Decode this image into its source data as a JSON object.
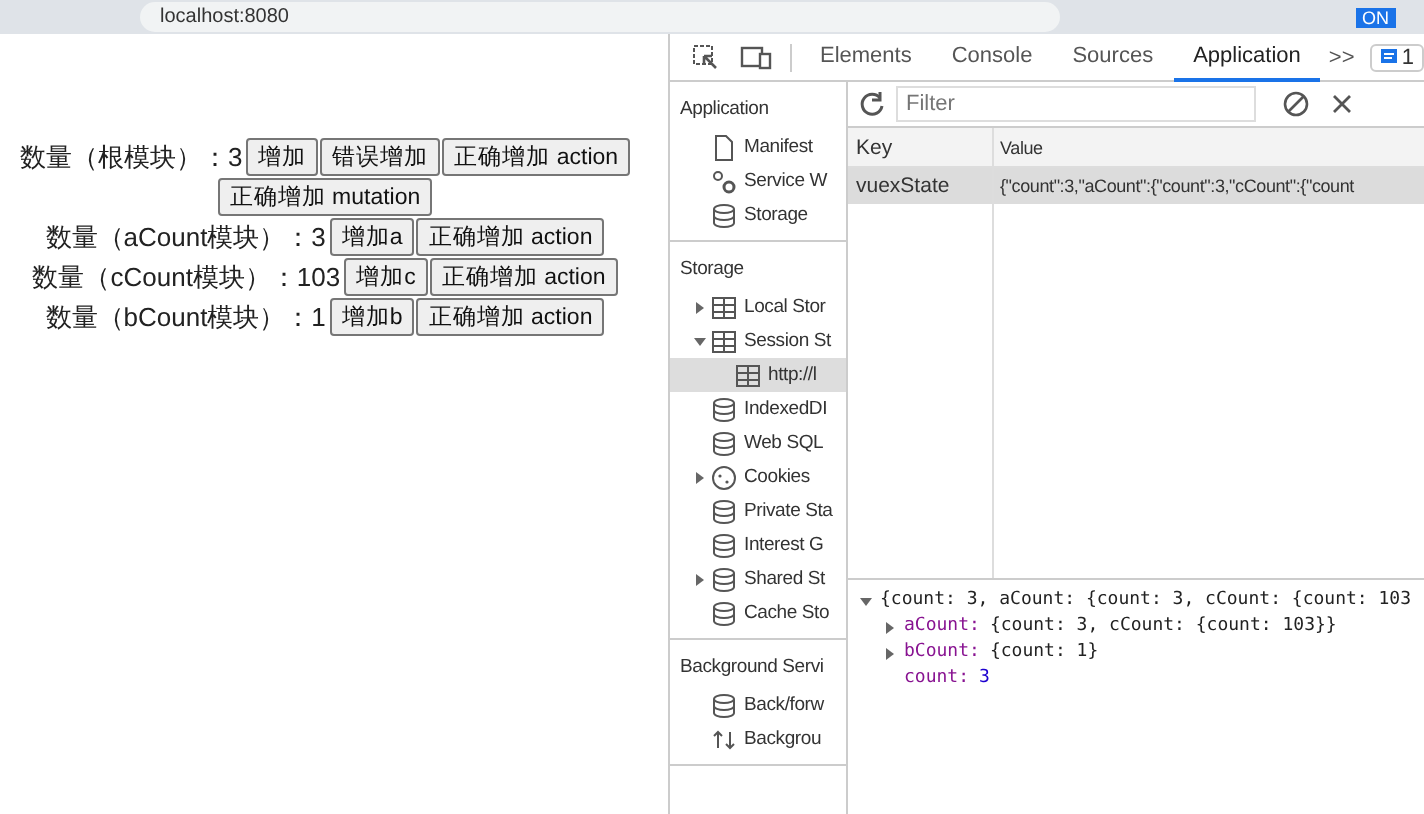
{
  "browser": {
    "address": "localhost:8080",
    "extension_badge": "ON"
  },
  "page": {
    "rows": [
      {
        "label": "数量（根模块）：3",
        "buttons": [
          "增加",
          "错误增加",
          "正确增加 action",
          "正确增加 mutation"
        ]
      },
      {
        "label": "数量（aCount模块）：3",
        "buttons": [
          "增加a",
          "正确增加 action"
        ]
      },
      {
        "label": "数量（cCount模块）：103",
        "buttons": [
          "增加c",
          "正确增加 action"
        ]
      },
      {
        "label": "数量（bCount模块）：1",
        "buttons": [
          "增加b",
          "正确增加 action"
        ]
      }
    ]
  },
  "devtools": {
    "tabs": [
      {
        "label": "Elements",
        "selected": false
      },
      {
        "label": "Console",
        "selected": false
      },
      {
        "label": "Sources",
        "selected": false
      },
      {
        "label": "Application",
        "selected": true
      }
    ],
    "more_tabs": ">>",
    "issues_count": "1",
    "sidebar": {
      "sections": [
        {
          "title": "Application",
          "items": [
            {
              "label": "Manifest",
              "kind": "file",
              "selected": false
            },
            {
              "label": "Service W",
              "kind": "gear",
              "selected": false
            },
            {
              "label": "Storage",
              "kind": "database",
              "selected": false
            }
          ]
        },
        {
          "title": "Storage",
          "items": [
            {
              "label": "Local Stor",
              "kind": "table",
              "expanded": false,
              "selected": false
            },
            {
              "label": "Session St",
              "kind": "table",
              "expanded": true,
              "selected": false,
              "children": [
                {
                  "label": "http://l",
                  "kind": "table",
                  "selected": true
                }
              ]
            },
            {
              "label": "IndexedDI",
              "kind": "database",
              "selected": false
            },
            {
              "label": "Web SQL",
              "kind": "database",
              "selected": false
            },
            {
              "label": "Cookies",
              "kind": "cookie",
              "expanded": false,
              "selected": false
            },
            {
              "label": "Private Sta",
              "kind": "database",
              "selected": false
            },
            {
              "label": "Interest G",
              "kind": "database",
              "selected": false
            },
            {
              "label": "Shared St",
              "kind": "database",
              "expanded": false,
              "selected": false
            },
            {
              "label": "Cache Sto",
              "kind": "database",
              "selected": false
            }
          ]
        },
        {
          "title": "Background Servi",
          "items": [
            {
              "label": "Back/forw",
              "kind": "database",
              "selected": false
            },
            {
              "label": "Backgrou",
              "kind": "arrows",
              "selected": false
            }
          ]
        }
      ]
    },
    "filter": {
      "placeholder": "Filter"
    },
    "table": {
      "columns": [
        "Key",
        "Value"
      ],
      "rows": [
        {
          "key": "vuexState",
          "value": "{\"count\":3,\"aCount\":{\"count\":3,\"cCount\":{\"count",
          "selected": true
        }
      ]
    },
    "preview": [
      {
        "text": "{count: 3, aCount: {count: 3, cCount: {count: 103",
        "expanded": true,
        "children": [
          {
            "key": "aCount:",
            "value": "{count: 3, cCount: {count: 103}}",
            "kind": "object",
            "expanded": false
          },
          {
            "key": "bCount:",
            "value": "{count: 1}",
            "kind": "object",
            "expanded": false
          },
          {
            "key": "count:",
            "value": "3",
            "kind": "number"
          }
        ]
      }
    ]
  }
}
